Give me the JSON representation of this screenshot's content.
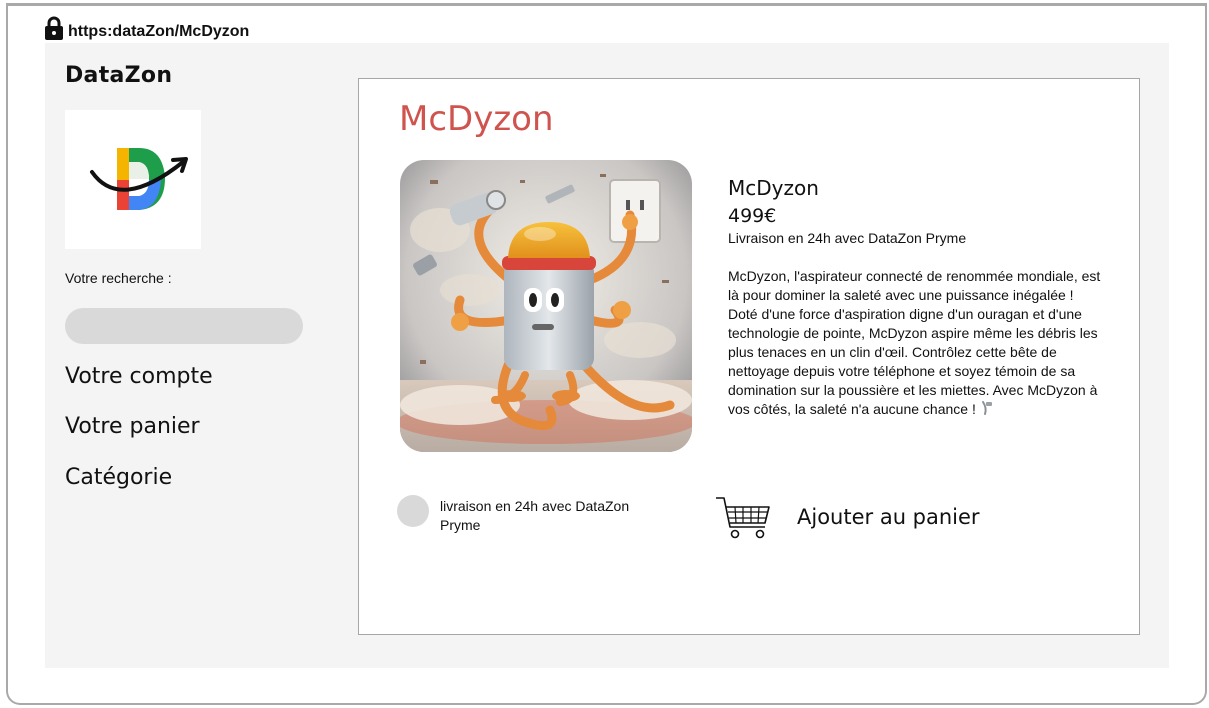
{
  "browser": {
    "url": "https:dataZon/McDyzon",
    "lock_icon": "lock-icon"
  },
  "sidebar": {
    "brand": "DataZon",
    "logo": {
      "letter": "D",
      "icon": "datazon-logo"
    },
    "search_label": "Votre recherche :",
    "search_placeholder": "",
    "nav": [
      {
        "label": "Votre compte"
      },
      {
        "label": "Votre panier"
      },
      {
        "label": "Catégorie"
      }
    ]
  },
  "product": {
    "page_title": "McDyzon",
    "name": "McDyzon",
    "price": "499€",
    "delivery": "Livraison en 24h avec DataZon Pryme",
    "description": "McDyzon, l'aspirateur connecté de renommée mondiale, est là pour dominer  la saleté avec une puissance inégalée ! Doté d'une force d'aspiration digne d'un ouragan et d'une technologie de pointe, McDyzon aspire même  les débris les plus tenaces en un clin d'œil. Contrôlez cette bête de  nettoyage depuis votre téléphone et soyez témoin de sa domination sur la  poussière et les miettes. Avec McDyzon à vos côtés, la saleté n'a  aucune chance !",
    "image_icon": "vacuum-robot-image",
    "delivery_option_label": "livraison en 24h avec DataZon Pryme",
    "add_to_cart_label": "Ajouter au panier",
    "cart_icon": "shopping-cart-icon"
  },
  "colors": {
    "title_accent": "#d0544e",
    "page_background": "#f4f4f4",
    "input_fill": "#d9d9d9"
  }
}
